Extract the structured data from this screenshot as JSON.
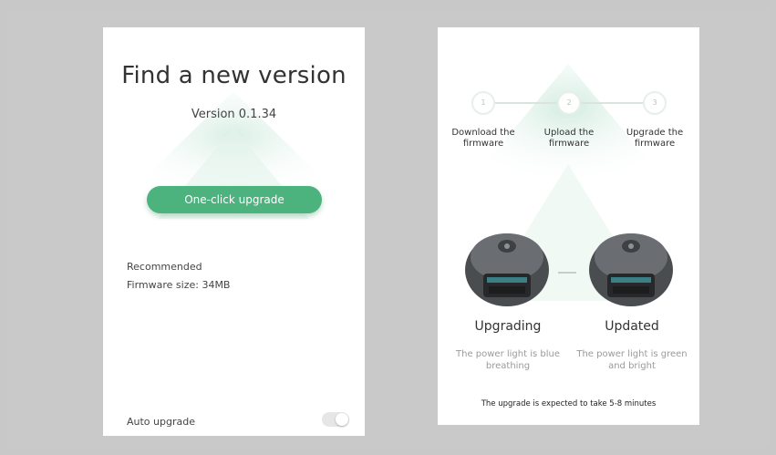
{
  "left_screen": {
    "title": "Find a new version",
    "version": "Version 0.1.34",
    "upgrade_button": "One-click upgrade",
    "recommended": "Recommended",
    "firmware_size": "Firmware size: 34MB",
    "auto_upgrade_label": "Auto upgrade",
    "auto_upgrade_on": false
  },
  "right_screen": {
    "steps": [
      {
        "number": "1",
        "label": "Download the firmware"
      },
      {
        "number": "2",
        "label": "Upload the firmware"
      },
      {
        "number": "3",
        "label": "Upgrade the firmware"
      }
    ],
    "states": [
      {
        "title": "Upgrading",
        "description": "The power light is blue breathing"
      },
      {
        "title": "Updated",
        "description": "The power light is green and bright"
      }
    ],
    "footer": "The upgrade is expected to take 5-8 minutes"
  },
  "colors": {
    "accent": "#4cb27e",
    "background": "#c9c9c9"
  }
}
